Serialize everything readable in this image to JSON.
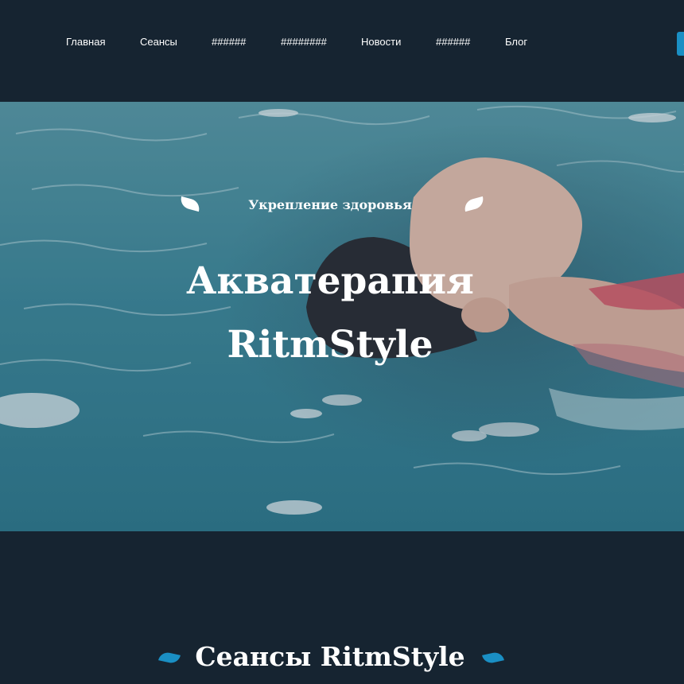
{
  "nav": {
    "items": [
      {
        "label": "Главная"
      },
      {
        "label": "Сеансы"
      },
      {
        "label": "######"
      },
      {
        "label": "########"
      },
      {
        "label": "Новости"
      },
      {
        "label": "######"
      },
      {
        "label": "Блог"
      }
    ]
  },
  "hero": {
    "kicker": "Укрепление здоровья",
    "title_line1": "Акватерапия",
    "title_line2": "RitmStyle"
  },
  "sessions": {
    "title": "Сеансы RitmStyle"
  },
  "colors": {
    "background": "#162431",
    "accent": "#1a8fc4",
    "text": "#ffffff"
  }
}
